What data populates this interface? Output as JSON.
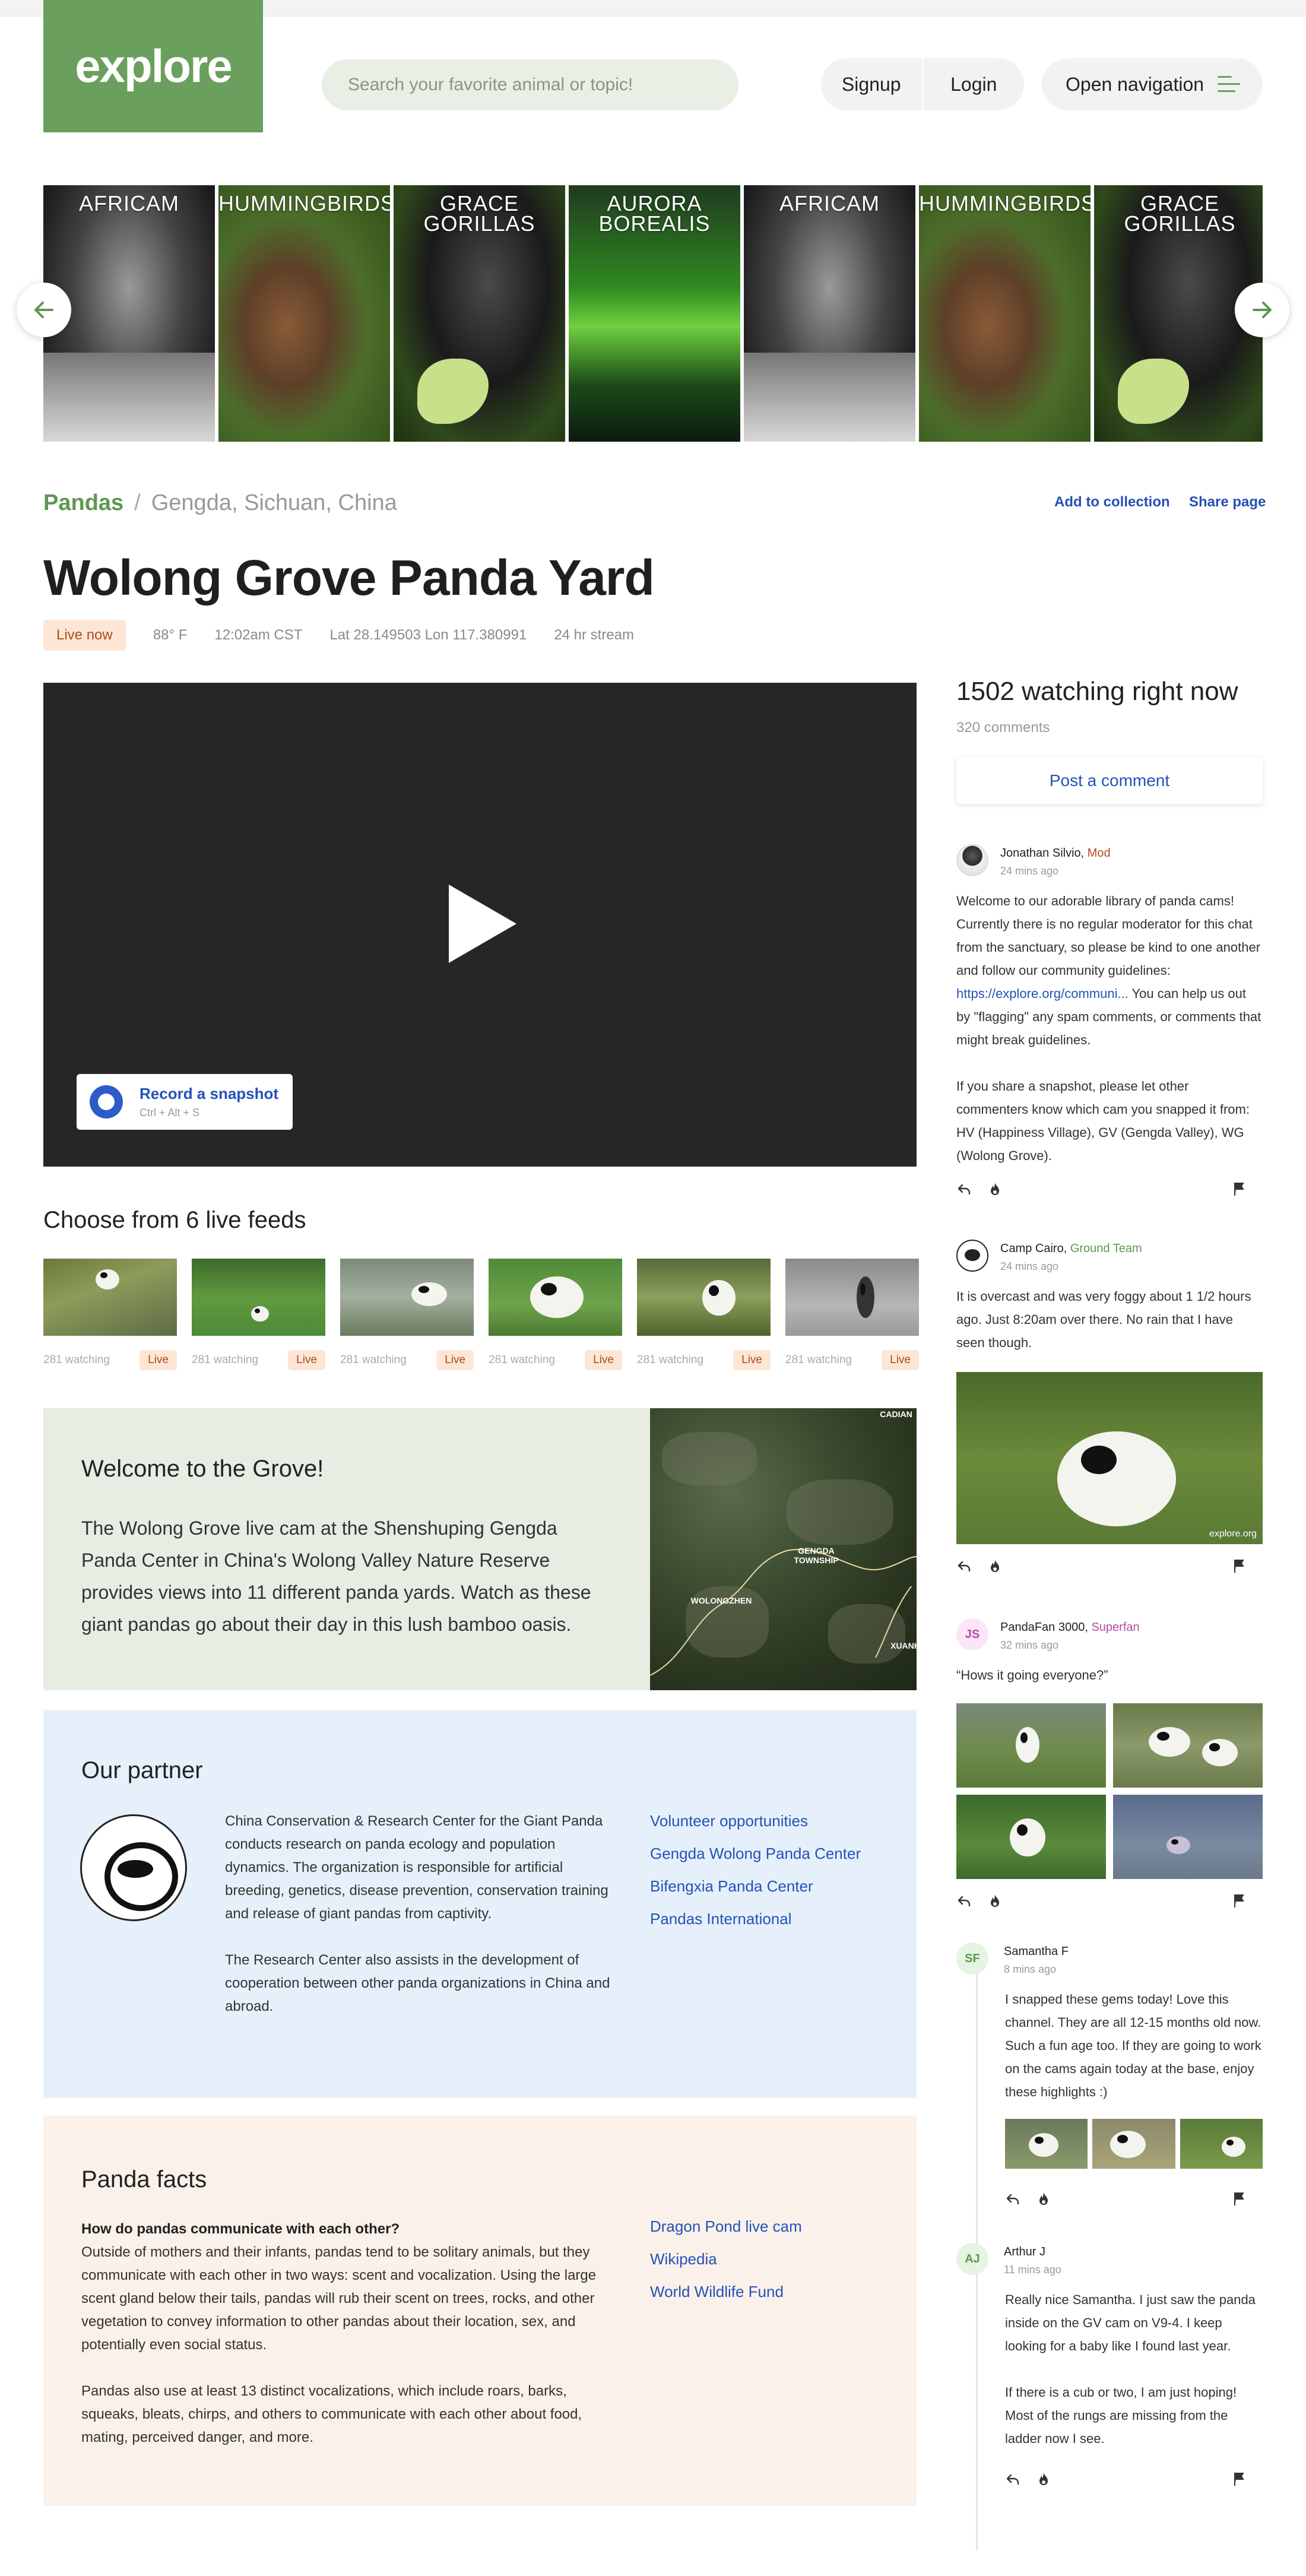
{
  "header": {
    "logo": "explore",
    "search_placeholder": "Search your favorite animal or topic!",
    "signup": "Signup",
    "login": "Login",
    "open_navigation": "Open navigation"
  },
  "carousel": {
    "tiles": [
      "AFRICAM",
      "HUMMINGBIRDS",
      "GRACE GORILLAS",
      "AURORA BOREALIS",
      "AFRICAM",
      "HUMMINGBIRDS",
      "GRACE GORILLAS"
    ]
  },
  "breadcrumb": {
    "category": "Pandas",
    "separator": "/",
    "location": "Gengda, Sichuan, China"
  },
  "actions": {
    "add_to_collection": "Add to collection",
    "share_page": "Share page"
  },
  "page": {
    "title": "Wolong Grove Panda Yard",
    "live_badge": "Live now",
    "temperature": "88° F",
    "time": "12:02am CST",
    "coords": "Lat 28.149503 Lon 117.380991",
    "stream": "24 hr stream"
  },
  "video": {
    "snapshot_label": "Record a snapshot",
    "snapshot_shortcut": "Ctrl + Alt + S"
  },
  "feeds": {
    "heading": "Choose from 6 live feeds",
    "items": [
      {
        "watching": "281 watching",
        "live": "Live"
      },
      {
        "watching": "281 watching",
        "live": "Live"
      },
      {
        "watching": "281 watching",
        "live": "Live"
      },
      {
        "watching": "281 watching",
        "live": "Live"
      },
      {
        "watching": "281 watching",
        "live": "Live"
      },
      {
        "watching": "281 watching",
        "live": "Live"
      }
    ]
  },
  "welcome": {
    "heading": "Welcome to the Grove!",
    "body": "The Wolong Grove live cam at the Shenshuping Gengda Panda Center in China's Wolong Valley Nature Reserve provides views into 11 different panda yards. Watch as these giant pandas go about their day in this lush bamboo oasis.",
    "map_labels": [
      "GENGDA TOWNSHIP",
      "WOLONGZHEN",
      "XUANK",
      "CADIAN"
    ]
  },
  "partner": {
    "heading": "Our partner",
    "p1": "China Conservation & Research Center for the Giant Panda conducts research on panda  ecology and population dynamics. The organization is responsible for artificial breeding, genetics, disease prevention, conservation training and release of giant pandas from captivity.",
    "p2": "The Research Center also assists in the development of cooperation between other panda organizations in China and abroad.",
    "links": [
      "Volunteer opportunities",
      "Gengda Wolong Panda Center",
      "Bifengxia  Panda Center",
      "Pandas International"
    ]
  },
  "facts": {
    "heading": "Panda facts",
    "question": "How do pandas communicate with each other?",
    "p1": "Outside of mothers and their infants, pandas tend to be solitary animals, but they communicate with each other in two ways: scent and vocalization. Using the large scent gland below their tails, pandas will rub their scent on trees, rocks, and other vegetation to convey information to other pandas about their location, sex, and potentially even social status.",
    "p2": "Pandas also use at least 13 distinct vocalizations, which include roars, barks, squeaks, bleats, chirps, and others to communicate with each other about food, mating, perceived danger, and more.",
    "links": [
      "Dragon Pond live cam",
      "Wikipedia",
      "World Wildlife Fund"
    ]
  },
  "sidebar": {
    "watching": "1502 watching right now",
    "comments_count": "320 comments",
    "post_comment": "Post a comment"
  },
  "comments": [
    {
      "name": "Jonathan Silvio,",
      "role": "Mod",
      "time": "24 mins ago",
      "p1_a": "Welcome to our adorable library of panda cams! Currently there is no regular moderator for this chat from the sanctuary, so please be kind to one another and follow our community guidelines: ",
      "p1_link": "https://explore.org/communi...",
      "p1_b": " You can help us out by \"flagging\" any spam comments, or comments that might break guidelines.",
      "p2": "If you share a snapshot, please let other commenters know which cam you snapped it from: HV (Happiness Village), GV (Gengda Valley), WG (Wolong Grove)."
    },
    {
      "name": "Camp Cairo,",
      "role": "Ground Team",
      "time": "24 mins ago",
      "body": "It is overcast and was very foggy about 1 1/2 hours ago. Just 8:20am over there. No rain that I have seen though.",
      "image_watermark": "explore.org"
    },
    {
      "name": "PandaFan 3000,",
      "role": "Superfan",
      "initials": "JS",
      "time": "32 mins ago",
      "body": "“Hows it going everyone?”"
    },
    {
      "name": "Samantha F",
      "initials": "SF",
      "time": "8 mins ago",
      "body": "I snapped these gems today! Love this channel. They are all 12-15 months old now. Such a fun age too. If they are going to work on the cams again today at the base, enjoy these highlights :)"
    },
    {
      "name": "Arthur J",
      "initials": "AJ",
      "time": "11 mins ago",
      "p1": "Really nice Samantha. I just saw the panda inside on the GV cam on V9-4. I keep looking for a baby like I found last year.",
      "p2": "If there is a cub or two, I am just hoping! Most of the rungs are missing from the ladder now I see."
    }
  ],
  "colors": {
    "brand_green": "#6a9f5d",
    "link_blue": "#2452b8",
    "live_bg": "#fde6d6",
    "live_text": "#b14a1b"
  }
}
